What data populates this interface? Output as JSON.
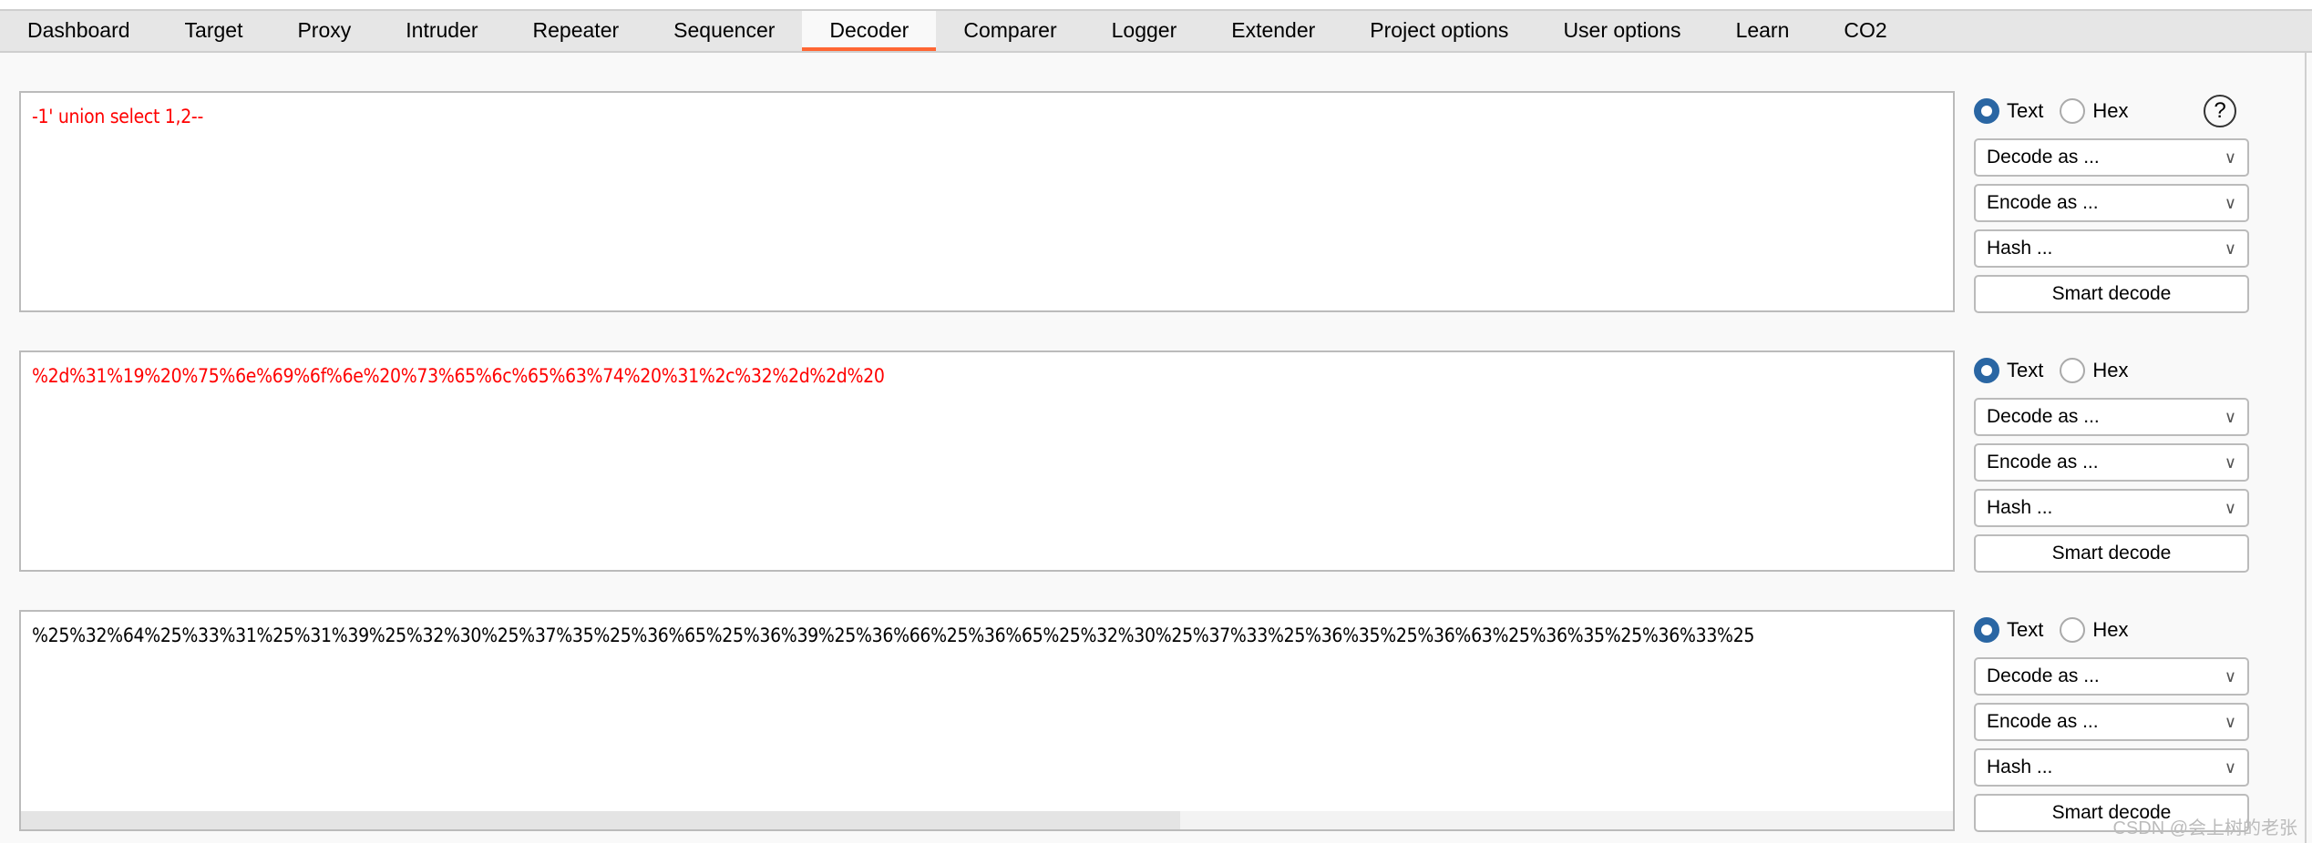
{
  "tabs": [
    "Dashboard",
    "Target",
    "Proxy",
    "Intruder",
    "Repeater",
    "Sequencer",
    "Decoder",
    "Comparer",
    "Logger",
    "Extender",
    "Project options",
    "User options",
    "Learn",
    "CO2"
  ],
  "active_tab": "Decoder",
  "accent": "#ff6633",
  "panels": [
    {
      "text": "-1' union select 1,2--",
      "color": "#ff0000",
      "mode": "Text"
    },
    {
      "text": "%2d%31%19%20%75%6e%69%6f%6e%20%73%65%6c%65%63%74%20%31%2c%32%2d%2d%20",
      "color": "#ff0000",
      "mode": "Text"
    },
    {
      "text": "%25%32%64%25%33%31%25%31%39%25%32%30%25%37%35%25%36%65%25%36%39%25%36%66%25%36%65%25%32%30%25%37%33%25%36%35%25%36%63%25%36%35%25%36%33%25",
      "color": "#000000",
      "mode": "Text",
      "hscroll_fraction": 0.6
    }
  ],
  "controls": {
    "text_label": "Text",
    "hex_label": "Hex",
    "decode": "Decode as ...",
    "encode": "Encode as ...",
    "hash": "Hash ...",
    "smart": "Smart decode",
    "help": "?",
    "chevron": "∨"
  },
  "watermark": "CSDN @会上树的老张"
}
